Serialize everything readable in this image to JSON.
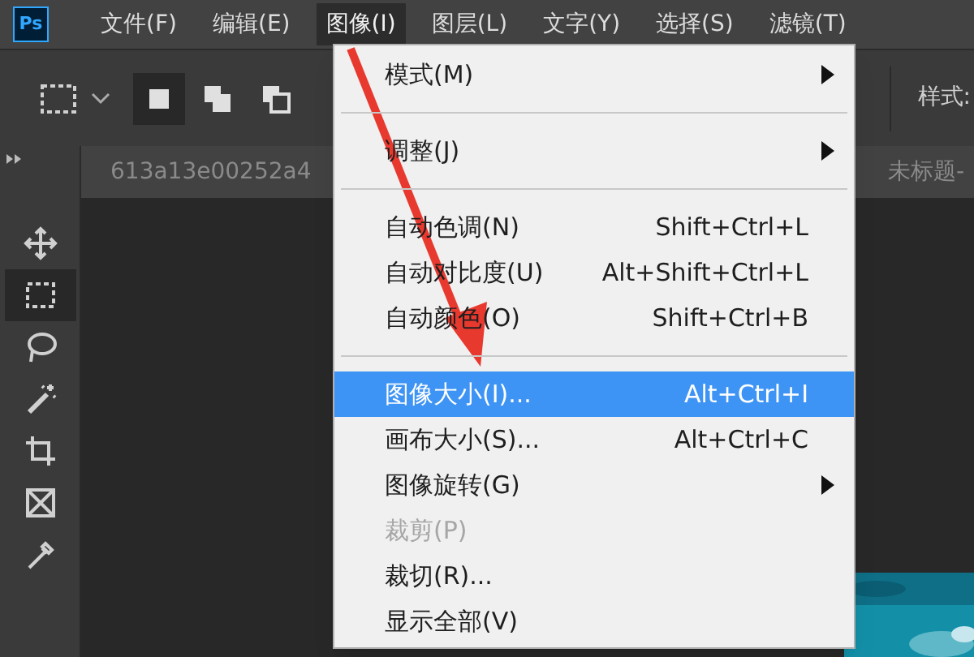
{
  "app": {
    "logo": "Ps"
  },
  "menubar": [
    {
      "label": "文件(F)",
      "selected": false
    },
    {
      "label": "编辑(E)",
      "selected": false
    },
    {
      "label": "图像(I)",
      "selected": true
    },
    {
      "label": "图层(L)",
      "selected": false
    },
    {
      "label": "文字(Y)",
      "selected": false
    },
    {
      "label": "选择(S)",
      "selected": false
    },
    {
      "label": "滤镜(T)",
      "selected": false
    }
  ],
  "options_bar": {
    "selection_modes": [
      {
        "selected": true
      },
      {
        "selected": false
      },
      {
        "selected": false
      }
    ],
    "style_label": "样式:"
  },
  "document_tabs": [
    {
      "title": "613a13e00252a4"
    },
    {
      "title": "未标题-"
    }
  ],
  "tools": [
    {
      "kind": "move",
      "selected": false
    },
    {
      "kind": "marquee",
      "selected": true
    },
    {
      "kind": "lasso",
      "selected": false
    },
    {
      "kind": "wand",
      "selected": false
    },
    {
      "kind": "crop",
      "selected": false
    },
    {
      "kind": "frame",
      "selected": false
    },
    {
      "kind": "eyedropper",
      "selected": false
    }
  ],
  "menu": [
    {
      "kind": "item",
      "label": "模式(M)",
      "submenu": true,
      "disabled": false,
      "selected": false
    },
    {
      "kind": "separator"
    },
    {
      "kind": "item",
      "label": "调整(J)",
      "submenu": true,
      "disabled": false,
      "selected": false
    },
    {
      "kind": "separator"
    },
    {
      "kind": "item",
      "label": "自动色调(N)",
      "shortcut": "Shift+Ctrl+L",
      "disabled": false,
      "selected": false
    },
    {
      "kind": "item",
      "label": "自动对比度(U)",
      "shortcut": "Alt+Shift+Ctrl+L",
      "disabled": false,
      "selected": false
    },
    {
      "kind": "item",
      "label": "自动颜色(O)",
      "shortcut": "Shift+Ctrl+B",
      "disabled": false,
      "selected": false
    },
    {
      "kind": "separator"
    },
    {
      "kind": "item",
      "label": "图像大小(I)...",
      "shortcut": "Alt+Ctrl+I",
      "disabled": false,
      "selected": true
    },
    {
      "kind": "item",
      "label": "画布大小(S)...",
      "shortcut": "Alt+Ctrl+C",
      "disabled": false,
      "selected": false
    },
    {
      "kind": "item",
      "label": "图像旋转(G)",
      "submenu": true,
      "disabled": false,
      "selected": false
    },
    {
      "kind": "item",
      "label": "裁剪(P)",
      "disabled": true,
      "selected": false
    },
    {
      "kind": "item",
      "label": "裁切(R)...",
      "disabled": false,
      "selected": false
    },
    {
      "kind": "item",
      "label": "显示全部(V)",
      "disabled": false,
      "selected": false
    }
  ]
}
